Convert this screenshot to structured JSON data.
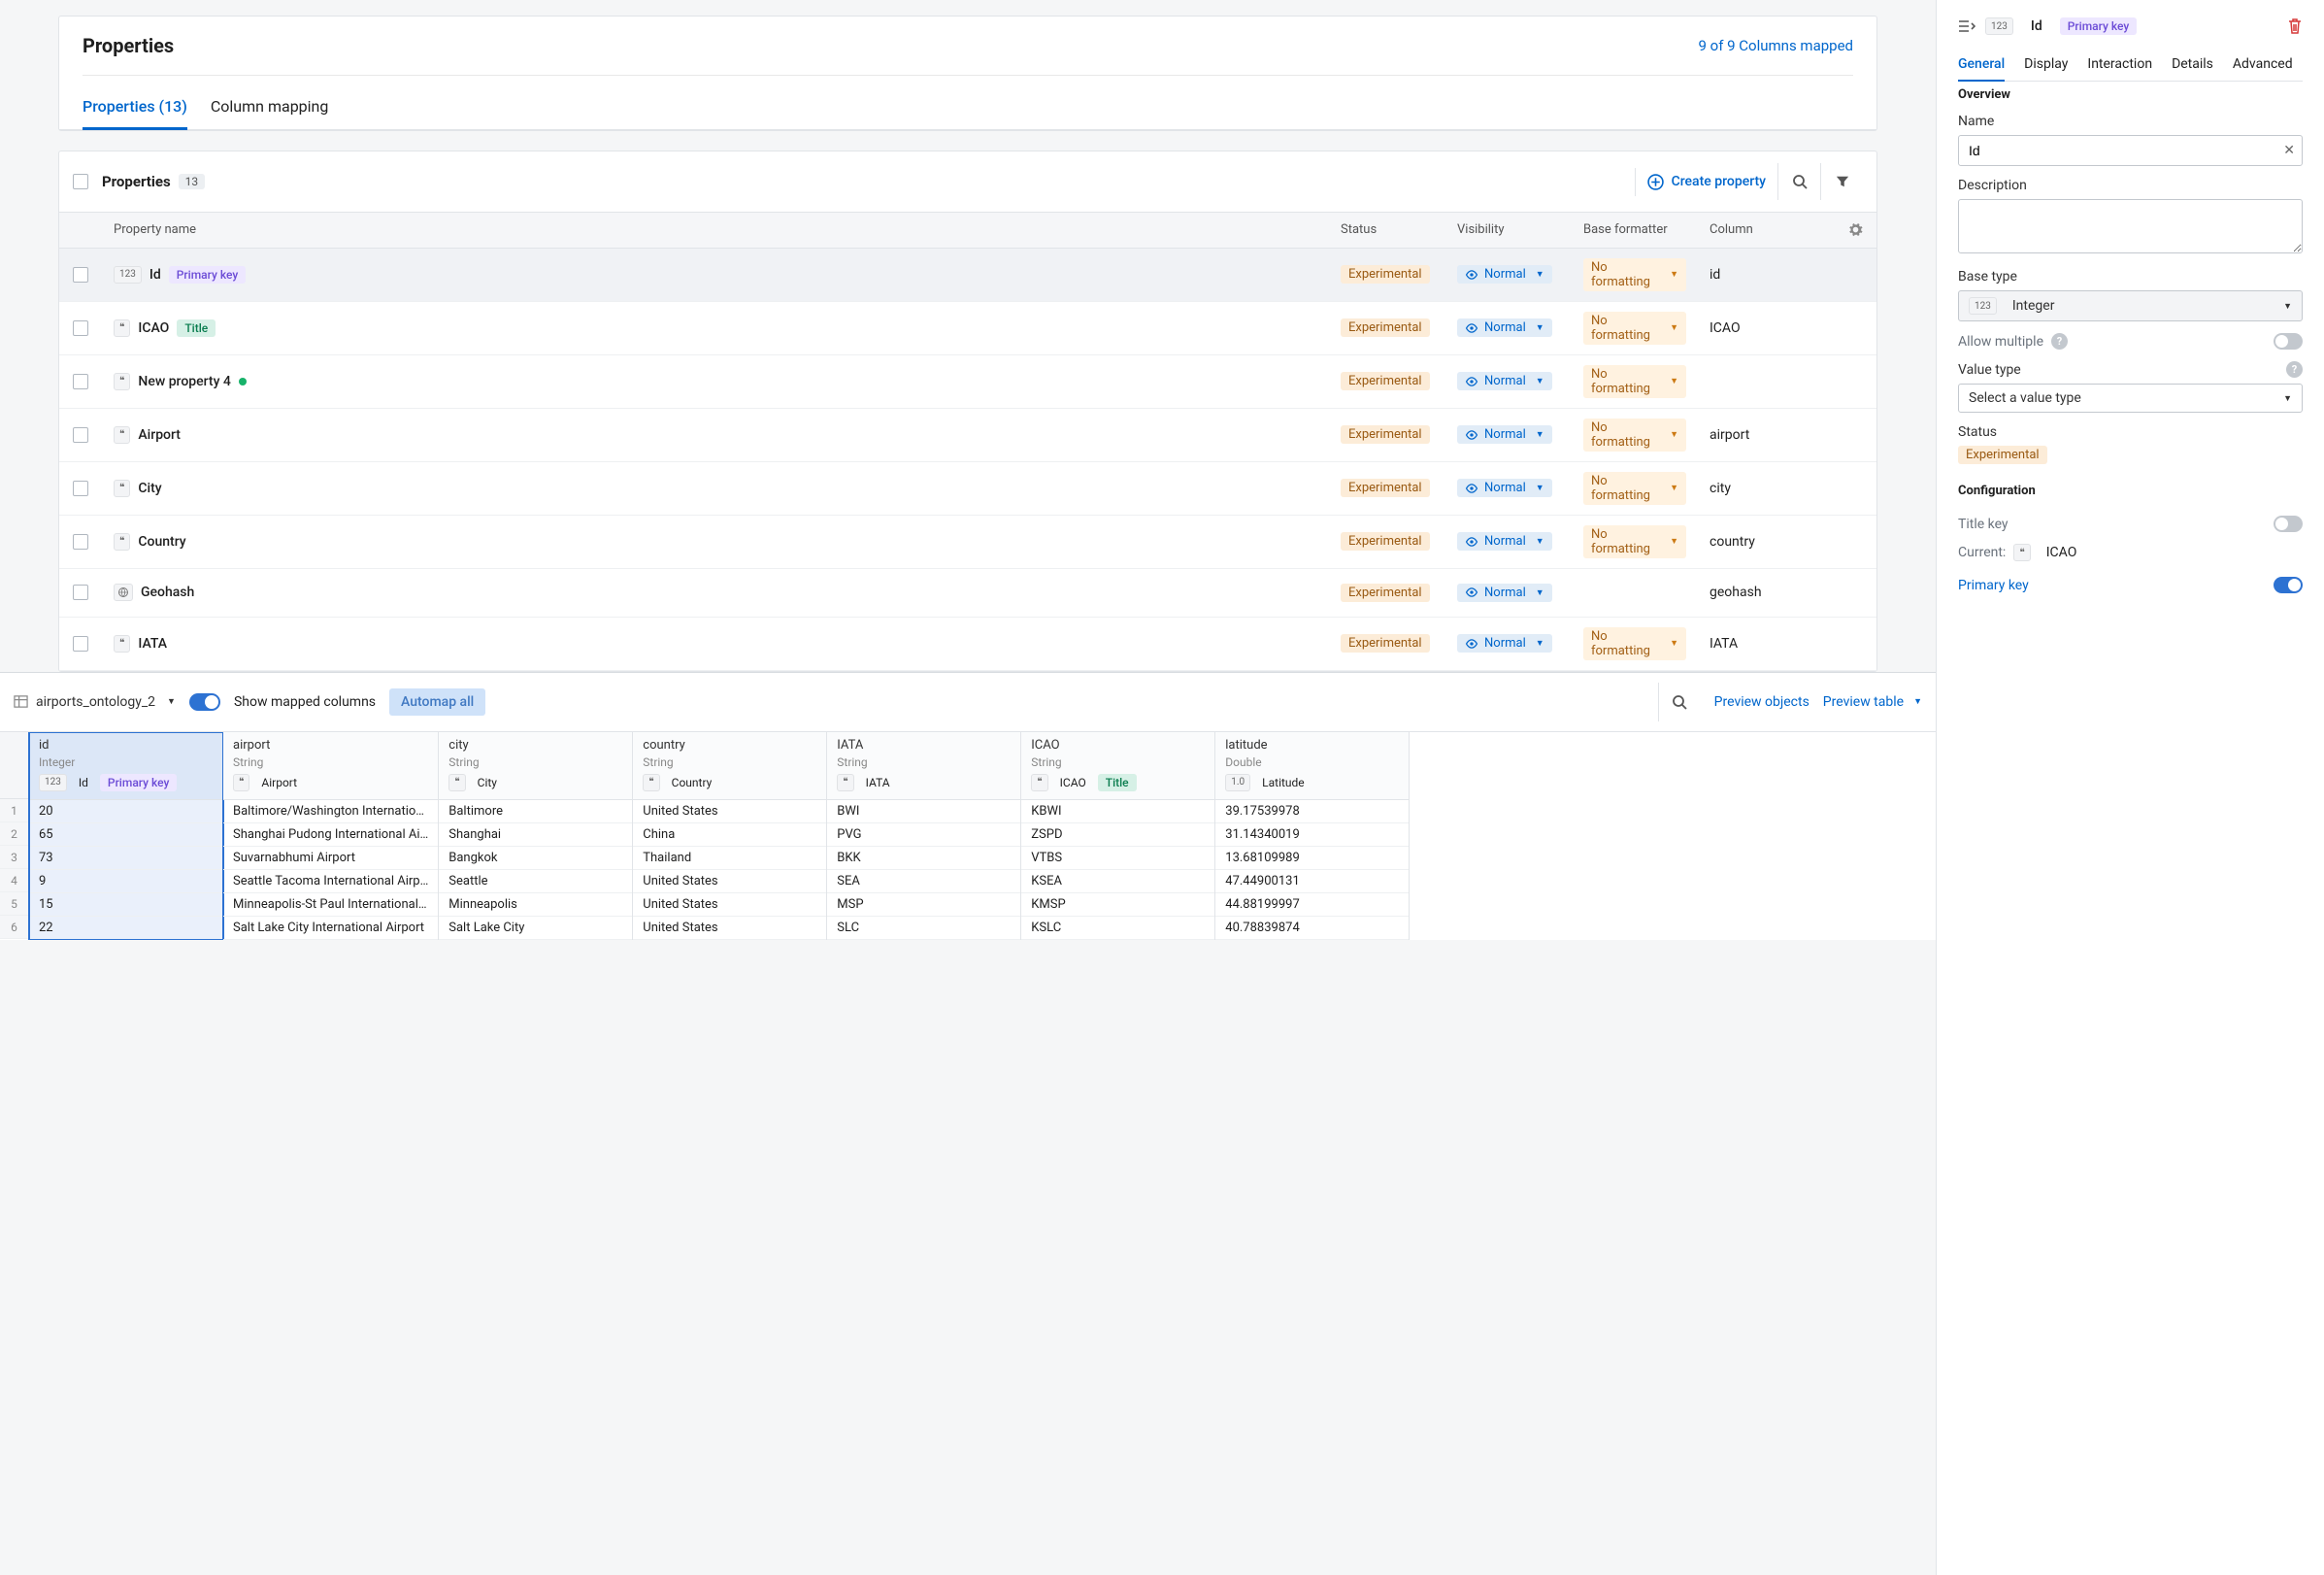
{
  "header": {
    "title": "Properties",
    "mapped": "9 of 9 Columns mapped",
    "tabs": [
      "Properties (13)",
      "Column mapping"
    ],
    "active_tab": 0
  },
  "propsToolbar": {
    "label": "Properties",
    "count": "13",
    "createLabel": "Create property"
  },
  "columns": {
    "name": "Property name",
    "status": "Status",
    "visibility": "Visibility",
    "formatter": "Base formatter",
    "column": "Column"
  },
  "rows": [
    {
      "type": "123",
      "name": "Id",
      "chip": "Primary key",
      "chipKind": "pk",
      "status": "Experimental",
      "vis": "Normal",
      "fmt": "No formatting",
      "col": "id",
      "selected": true
    },
    {
      "type": "quote",
      "name": "ICAO",
      "chip": "Title",
      "chipKind": "ttl",
      "status": "Experimental",
      "vis": "Normal",
      "fmt": "No formatting",
      "col": "ICAO"
    },
    {
      "type": "quote",
      "name": "New property 4",
      "dot": true,
      "status": "Experimental",
      "vis": "Normal",
      "fmt": "No formatting",
      "col": ""
    },
    {
      "type": "quote",
      "name": "Airport",
      "status": "Experimental",
      "vis": "Normal",
      "fmt": "No formatting",
      "col": "airport"
    },
    {
      "type": "quote",
      "name": "City",
      "status": "Experimental",
      "vis": "Normal",
      "fmt": "No formatting",
      "col": "city"
    },
    {
      "type": "quote",
      "name": "Country",
      "status": "Experimental",
      "vis": "Normal",
      "fmt": "No formatting",
      "col": "country"
    },
    {
      "type": "geo",
      "name": "Geohash",
      "status": "Experimental",
      "vis": "Normal",
      "fmt": "",
      "col": "geohash"
    },
    {
      "type": "quote",
      "name": "IATA",
      "status": "Experimental",
      "vis": "Normal",
      "fmt": "No formatting",
      "col": "IATA"
    }
  ],
  "side": {
    "titleType": "123",
    "titleName": "Id",
    "titleChip": "Primary key",
    "tabs": [
      "General",
      "Display",
      "Interaction",
      "Details",
      "Advanced"
    ],
    "activeTab": 0,
    "overview": "Overview",
    "nameLabel": "Name",
    "nameValue": "Id",
    "descLabel": "Description",
    "baseTypeLabel": "Base type",
    "baseTypeValue": "Integer",
    "allowMultiple": "Allow multiple",
    "valueTypeLabel": "Value type",
    "valueTypePh": "Select a value type",
    "statusLabel": "Status",
    "statusValue": "Experimental",
    "configLabel": "Configuration",
    "titleKey": "Title key",
    "currentLabel": "Current:",
    "currentVal": "ICAO",
    "primaryKey": "Primary key"
  },
  "bottom": {
    "dsName": "airports_ontology_2",
    "showMapped": "Show mapped columns",
    "automap": "Automap all",
    "previewObjects": "Preview objects",
    "previewTable": "Preview table",
    "cols": [
      {
        "id": "id",
        "type": "Integer",
        "map": "Id",
        "mapType": "123",
        "chip": "Primary key",
        "chipKind": "pk",
        "sel": true
      },
      {
        "id": "airport",
        "type": "String",
        "map": "Airport",
        "mapType": "quote"
      },
      {
        "id": "city",
        "type": "String",
        "map": "City",
        "mapType": "quote"
      },
      {
        "id": "country",
        "type": "String",
        "map": "Country",
        "mapType": "quote"
      },
      {
        "id": "IATA",
        "type": "String",
        "map": "IATA",
        "mapType": "quote"
      },
      {
        "id": "ICAO",
        "type": "String",
        "map": "ICAO",
        "mapType": "quote",
        "chip": "Title",
        "chipKind": "ttl"
      },
      {
        "id": "latitude",
        "type": "Double",
        "map": "Latitude",
        "mapType": "1.0"
      }
    ],
    "data": [
      [
        "20",
        "Baltimore/Washington Internatio…",
        "Baltimore",
        "United States",
        "BWI",
        "KBWI",
        "39.17539978"
      ],
      [
        "65",
        "Shanghai Pudong International Ai…",
        "Shanghai",
        "China",
        "PVG",
        "ZSPD",
        "31.14340019"
      ],
      [
        "73",
        "Suvarnabhumi Airport",
        "Bangkok",
        "Thailand",
        "BKK",
        "VTBS",
        "13.68109989"
      ],
      [
        "9",
        "Seattle Tacoma International Airp…",
        "Seattle",
        "United States",
        "SEA",
        "KSEA",
        "47.44900131"
      ],
      [
        "15",
        "Minneapolis-St Paul International…",
        "Minneapolis",
        "United States",
        "MSP",
        "KMSP",
        "44.88199997"
      ],
      [
        "22",
        "Salt Lake City International Airport",
        "Salt Lake City",
        "United States",
        "SLC",
        "KSLC",
        "40.78839874"
      ]
    ]
  }
}
